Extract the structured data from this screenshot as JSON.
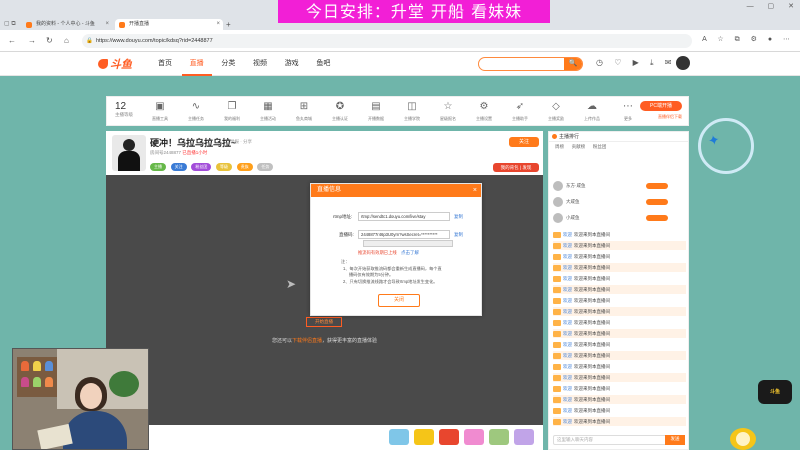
{
  "browser": {
    "tabs": [
      {
        "label": "我的资料 - 个人中心 - 斗鱼"
      },
      {
        "label": "开播直播"
      }
    ],
    "new_tab": "+",
    "url": "https://www.douyu.com/topic/kdsq?rid=2448877"
  },
  "overlay_banner": "今日安排：升堂  开船  看妹妹",
  "site": {
    "logo": "斗鱼",
    "nav": [
      "首页",
      "直播",
      "分类",
      "视频",
      "游戏",
      "鱼吧"
    ],
    "search_button": "🔍",
    "colors": {
      "brand": "#ff5d23",
      "accent": "#ff7a1a",
      "background": "#6fb5aa"
    }
  },
  "roombar": {
    "level": "12",
    "level_sub": "主播等级",
    "features": [
      "直播工具",
      "主播任务",
      "我的福利",
      "主播活动",
      "鱼丸商城",
      "主播认证",
      "开播数据",
      "主播学院",
      "星级报名",
      "主播设置",
      "主播助手",
      "主播奖励",
      "上传作品",
      "更多"
    ],
    "pc_button": "PC端开播",
    "pc_sub": "直播伴侣下载"
  },
  "anchor": {
    "title": "硬冲！乌拉乌拉乌拉~",
    "meta": "举报  · 分享",
    "sub_left": "房间号2448877",
    "sub_red": "已直播1小时",
    "follow": "关注",
    "tags": [
      "主播",
      "关注",
      "粉丝团",
      "等级",
      "贵族",
      "任务"
    ],
    "gift_button": "我的背包 | 发现"
  },
  "player": {
    "note_prefix": "您还可以",
    "note_link": "下载伴侣直播",
    "note_suffix": "，获得更丰富的直播体验",
    "red_button": "开始直播"
  },
  "chat": {
    "header": "主播排行",
    "tabs": [
      "周榜",
      "贡献榜",
      "粉丝团"
    ],
    "rank": [
      "东方·咸鱼",
      "大咸鱼",
      "小咸鱼"
    ],
    "messages": [
      {
        "name": "欢迎",
        "text": "欢迎来到本直播间"
      },
      {
        "name": "欢迎",
        "text": "欢迎来到本直播间"
      },
      {
        "name": "欢迎",
        "text": "欢迎来到本直播间"
      },
      {
        "name": "欢迎",
        "text": "欢迎来到本直播间"
      },
      {
        "name": "欢迎",
        "text": "欢迎来到本直播间"
      },
      {
        "name": "欢迎",
        "text": "欢迎来到本直播间"
      },
      {
        "name": "欢迎",
        "text": "欢迎来到本直播间"
      },
      {
        "name": "欢迎",
        "text": "欢迎来到本直播间"
      },
      {
        "name": "欢迎",
        "text": "欢迎来到本直播间"
      },
      {
        "name": "欢迎",
        "text": "欢迎来到本直播间"
      },
      {
        "name": "欢迎",
        "text": "欢迎来到本直播间"
      },
      {
        "name": "欢迎",
        "text": "欢迎来到本直播间"
      },
      {
        "name": "欢迎",
        "text": "欢迎来到本直播间"
      },
      {
        "name": "欢迎",
        "text": "欢迎来到本直播间"
      },
      {
        "name": "欢迎",
        "text": "欢迎来到本直播间"
      },
      {
        "name": "欢迎",
        "text": "欢迎来到本直播间"
      },
      {
        "name": "欢迎",
        "text": "欢迎来到本直播间"
      },
      {
        "name": "欢迎",
        "text": "欢迎来到本直播间"
      }
    ],
    "input_placeholder": "这里输入聊天内容",
    "send": "发送"
  },
  "modal": {
    "title": "直播信息",
    "close": "×",
    "rtmp_label": "rtmp地址:",
    "rtmp_value": "rtmp://sendtc1.douyu.com/live/stay",
    "copy1": "复制",
    "code_label": "直播码:",
    "code_value": "2448877r46p3U0yrn?wsSecret=**********",
    "copy2": "复制",
    "dropdown": "",
    "red_link": "推流码有效期已上线",
    "learn_more": "点击了解",
    "notes_title": "注：",
    "note1": "1、每次开始获取推流码都会重新生成直播码，每个直",
    "note1b": "播码仅有效期为5分钟。",
    "note2": "2、只有切换推流线路才会导致rtmp地址发生变化。",
    "close_button": "关闭"
  },
  "webcam": {
    "colors": {
      "wall": "#c9c2b5",
      "shirt": "#2c4a7a",
      "plant": "#3f7a3a"
    }
  },
  "mascot": {
    "logo": "斗鱼"
  }
}
